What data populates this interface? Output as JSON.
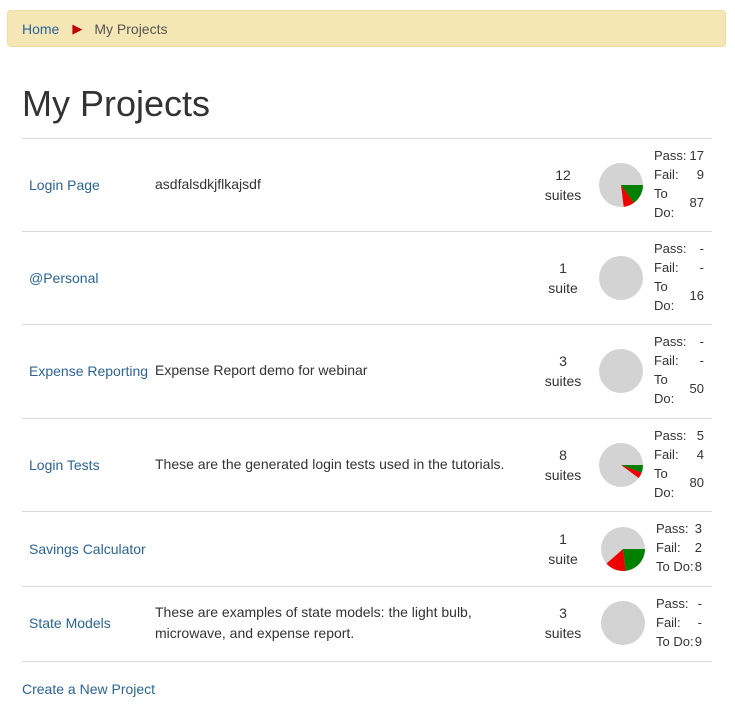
{
  "breadcrumb": {
    "home": "Home",
    "current": "My Projects"
  },
  "page_title": "My Projects",
  "projects": [
    {
      "name": "Login Page",
      "description": "asdfalsdkjflkajsdf",
      "suites_count": "12",
      "suites_unit": "suites",
      "pass_label": "Pass:",
      "pass": "17",
      "fail_label": "Fail:",
      "fail": "9",
      "todo_label": "To Do:",
      "todo": "87",
      "pass_n": 17,
      "fail_n": 9,
      "todo_n": 87
    },
    {
      "name": "@Personal",
      "description": "",
      "suites_count": "1",
      "suites_unit": "suite",
      "pass_label": "Pass:",
      "pass": "-",
      "fail_label": "Fail:",
      "fail": "-",
      "todo_label": "To Do:",
      "todo": "16",
      "pass_n": 0,
      "fail_n": 0,
      "todo_n": 16
    },
    {
      "name": "Expense Reporting",
      "description": "Expense Report demo for webinar",
      "suites_count": "3",
      "suites_unit": "suites",
      "pass_label": "Pass:",
      "pass": "-",
      "fail_label": "Fail:",
      "fail": "-",
      "todo_label": "To Do:",
      "todo": "50",
      "pass_n": 0,
      "fail_n": 0,
      "todo_n": 50
    },
    {
      "name": "Login Tests",
      "description": "These are the generated login tests used in the tutorials.",
      "suites_count": "8",
      "suites_unit": "suites",
      "pass_label": "Pass:",
      "pass": "5",
      "fail_label": "Fail:",
      "fail": "4",
      "todo_label": "To Do:",
      "todo": "80",
      "pass_n": 5,
      "fail_n": 4,
      "todo_n": 80
    },
    {
      "name": "Savings Calculator",
      "description": "",
      "suites_count": "1",
      "suites_unit": "suite",
      "pass_label": "Pass:",
      "pass": "3",
      "fail_label": "Fail:",
      "fail": "2",
      "todo_label": "To Do:",
      "todo": "8",
      "pass_n": 3,
      "fail_n": 2,
      "todo_n": 8
    },
    {
      "name": "State Models",
      "description": "These are examples of state models: the light bulb, microwave, and expense report.",
      "suites_count": "3",
      "suites_unit": "suites",
      "pass_label": "Pass:",
      "pass": "-",
      "fail_label": "Fail:",
      "fail": "-",
      "todo_label": "To Do:",
      "todo": "9",
      "pass_n": 0,
      "fail_n": 0,
      "todo_n": 9
    }
  ],
  "create_link": "Create a New Project",
  "colors": {
    "link": "#2a6496",
    "pass": "#008000",
    "fail": "#ee0000",
    "todo": "#d3d3d3",
    "breadcrumb_bg": "#f5e7b5",
    "separator": "#c00000"
  }
}
